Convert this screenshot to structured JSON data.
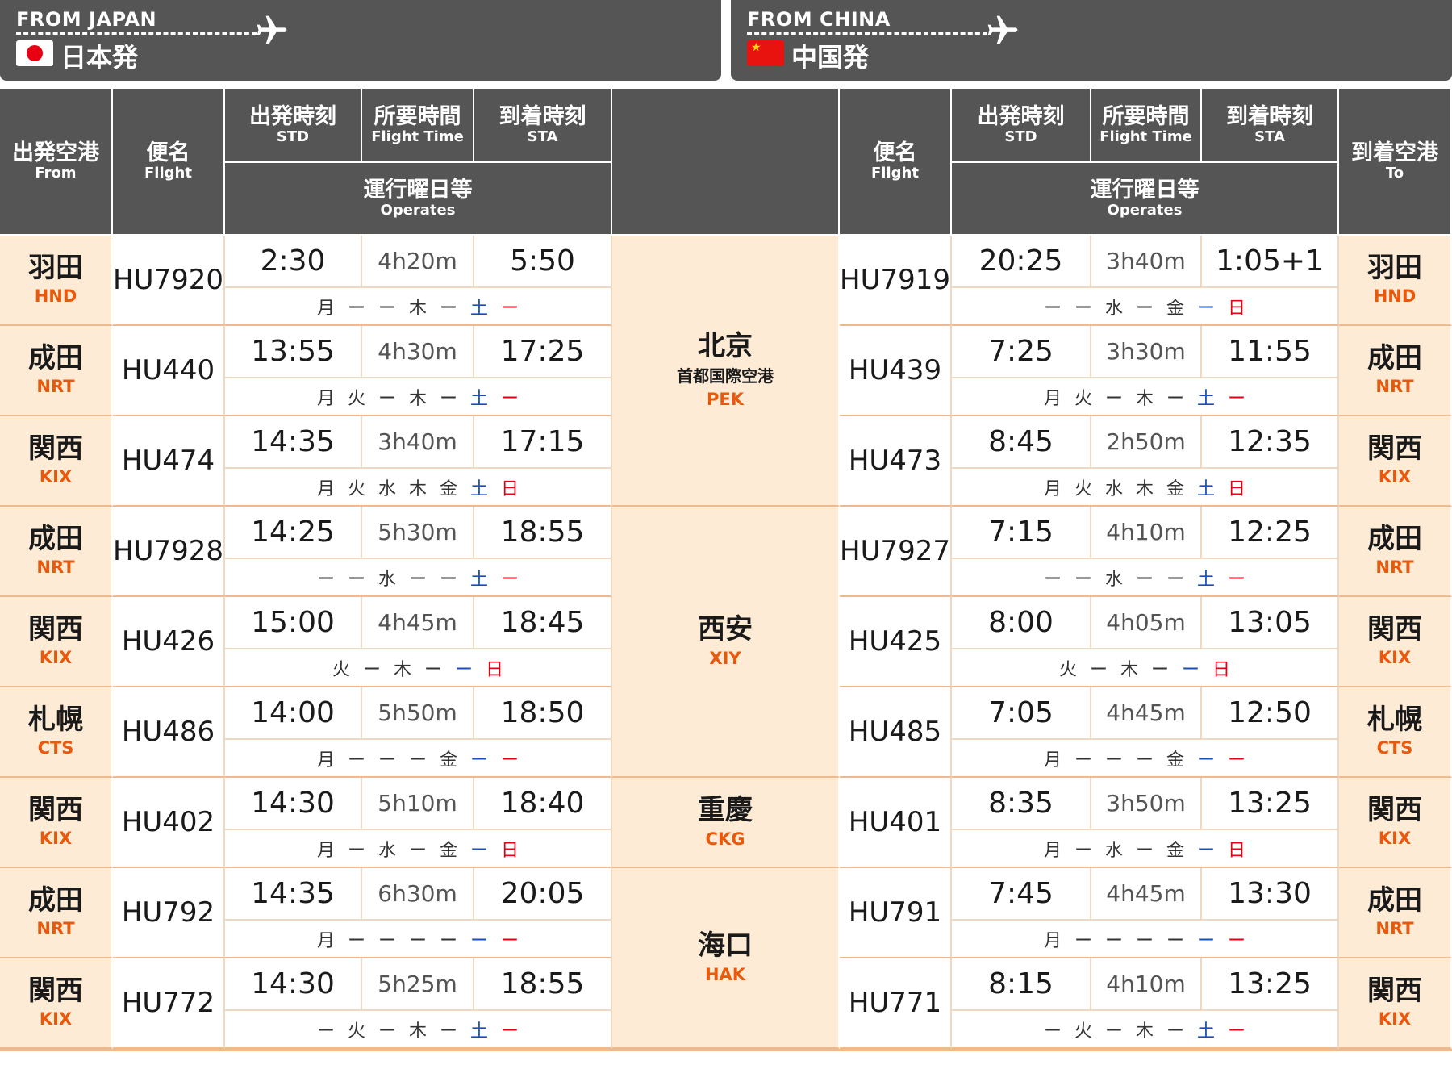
{
  "banners": {
    "japan": {
      "tag": "FROM JAPAN",
      "title": "日本発",
      "flag_icon": "japan-flag-icon"
    },
    "china": {
      "tag": "FROM CHINA",
      "title": "中国発",
      "flag_icon": "china-flag-icon"
    }
  },
  "headers": {
    "from": {
      "jp": "出発空港",
      "en": "From"
    },
    "flight": {
      "jp": "便名",
      "en": "Flight"
    },
    "std": {
      "jp": "出発時刻",
      "en": "STD"
    },
    "flight_time": {
      "jp": "所要時間",
      "en": "Flight Time"
    },
    "sta": {
      "jp": "到着時刻",
      "en": "STA"
    },
    "operates": {
      "jp": "運行曜日等",
      "en": "Operates"
    },
    "to": {
      "jp": "到着空港",
      "en": "To"
    }
  },
  "cities": [
    {
      "name": "北京",
      "sub": "首都国際空港",
      "code": "PEK"
    },
    {
      "name": "西安",
      "sub": "",
      "code": "XIY"
    },
    {
      "name": "重慶",
      "sub": "",
      "code": "CKG"
    },
    {
      "name": "海口",
      "sub": "",
      "code": "HAK"
    }
  ],
  "rows": [
    {
      "jp": {
        "name": "羽田",
        "code": "HND"
      },
      "out": {
        "flight": "HU7920",
        "std": "2:30",
        "ft": "4h20m",
        "sta": "5:50",
        "days": [
          "月",
          "ー",
          "ー",
          "木",
          "ー",
          "土",
          "ー"
        ]
      },
      "back": {
        "flight": "HU7919",
        "std": "20:25",
        "ft": "3h40m",
        "sta": "1:05+1",
        "days": [
          "ー",
          "ー",
          "水",
          "ー",
          "金",
          "ー",
          "日"
        ]
      }
    },
    {
      "jp": {
        "name": "成田",
        "code": "NRT"
      },
      "out": {
        "flight": "HU440",
        "std": "13:55",
        "ft": "4h30m",
        "sta": "17:25",
        "days": [
          "月",
          "火",
          "ー",
          "木",
          "ー",
          "土",
          "ー"
        ]
      },
      "back": {
        "flight": "HU439",
        "std": "7:25",
        "ft": "3h30m",
        "sta": "11:55",
        "days": [
          "月",
          "火",
          "ー",
          "木",
          "ー",
          "土",
          "ー"
        ]
      }
    },
    {
      "jp": {
        "name": "関西",
        "code": "KIX"
      },
      "out": {
        "flight": "HU474",
        "std": "14:35",
        "ft": "3h40m",
        "sta": "17:15",
        "days": [
          "月",
          "火",
          "水",
          "木",
          "金",
          "土",
          "日"
        ]
      },
      "back": {
        "flight": "HU473",
        "std": "8:45",
        "ft": "2h50m",
        "sta": "12:35",
        "days": [
          "月",
          "火",
          "水",
          "木",
          "金",
          "土",
          "日"
        ]
      }
    },
    {
      "jp": {
        "name": "成田",
        "code": "NRT"
      },
      "out": {
        "flight": "HU7928",
        "std": "14:25",
        "ft": "5h30m",
        "sta": "18:55",
        "days": [
          "ー",
          "ー",
          "水",
          "ー",
          "ー",
          "土",
          "ー"
        ]
      },
      "back": {
        "flight": "HU7927",
        "std": "7:15",
        "ft": "4h10m",
        "sta": "12:25",
        "days": [
          "ー",
          "ー",
          "水",
          "ー",
          "ー",
          "土",
          "ー"
        ]
      }
    },
    {
      "jp": {
        "name": "関西",
        "code": "KIX"
      },
      "out": {
        "flight": "HU426",
        "std": "15:00",
        "ft": "4h45m",
        "sta": "18:45",
        "days": [
          "火",
          "ー",
          "木",
          "ー",
          "ー",
          "日"
        ]
      },
      "back": {
        "flight": "HU425",
        "std": "8:00",
        "ft": "4h05m",
        "sta": "13:05",
        "days": [
          "火",
          "ー",
          "木",
          "ー",
          "ー",
          "日"
        ]
      }
    },
    {
      "jp": {
        "name": "札幌",
        "code": "CTS"
      },
      "out": {
        "flight": "HU486",
        "std": "14:00",
        "ft": "5h50m",
        "sta": "18:50",
        "days": [
          "月",
          "ー",
          "ー",
          "ー",
          "金",
          "ー",
          "ー"
        ]
      },
      "back": {
        "flight": "HU485",
        "std": "7:05",
        "ft": "4h45m",
        "sta": "12:50",
        "days": [
          "月",
          "ー",
          "ー",
          "ー",
          "金",
          "ー",
          "ー"
        ]
      }
    },
    {
      "jp": {
        "name": "関西",
        "code": "KIX"
      },
      "out": {
        "flight": "HU402",
        "std": "14:30",
        "ft": "5h10m",
        "sta": "18:40",
        "days": [
          "月",
          "ー",
          "水",
          "ー",
          "金",
          "ー",
          "日"
        ]
      },
      "back": {
        "flight": "HU401",
        "std": "8:35",
        "ft": "3h50m",
        "sta": "13:25",
        "days": [
          "月",
          "ー",
          "水",
          "ー",
          "金",
          "ー",
          "日"
        ]
      }
    },
    {
      "jp": {
        "name": "成田",
        "code": "NRT"
      },
      "out": {
        "flight": "HU792",
        "std": "14:35",
        "ft": "6h30m",
        "sta": "20:05",
        "days": [
          "月",
          "ー",
          "ー",
          "ー",
          "ー",
          "ー",
          "ー"
        ]
      },
      "back": {
        "flight": "HU791",
        "std": "7:45",
        "ft": "4h45m",
        "sta": "13:30",
        "days": [
          "月",
          "ー",
          "ー",
          "ー",
          "ー",
          "ー",
          "ー"
        ]
      }
    },
    {
      "jp": {
        "name": "関西",
        "code": "KIX"
      },
      "out": {
        "flight": "HU772",
        "std": "14:30",
        "ft": "5h25m",
        "sta": "18:55",
        "days": [
          "ー",
          "火",
          "ー",
          "木",
          "ー",
          "土",
          "ー"
        ]
      },
      "back": {
        "flight": "HU771",
        "std": "8:15",
        "ft": "4h10m",
        "sta": "13:25",
        "days": [
          "ー",
          "火",
          "ー",
          "木",
          "ー",
          "土",
          "ー"
        ]
      }
    }
  ],
  "colors": {
    "header_bg": "#555555",
    "cell_bg": "#fdebd6",
    "code": "#e8590c",
    "saturday": "#1b4fb5",
    "sunday": "#e60012"
  }
}
